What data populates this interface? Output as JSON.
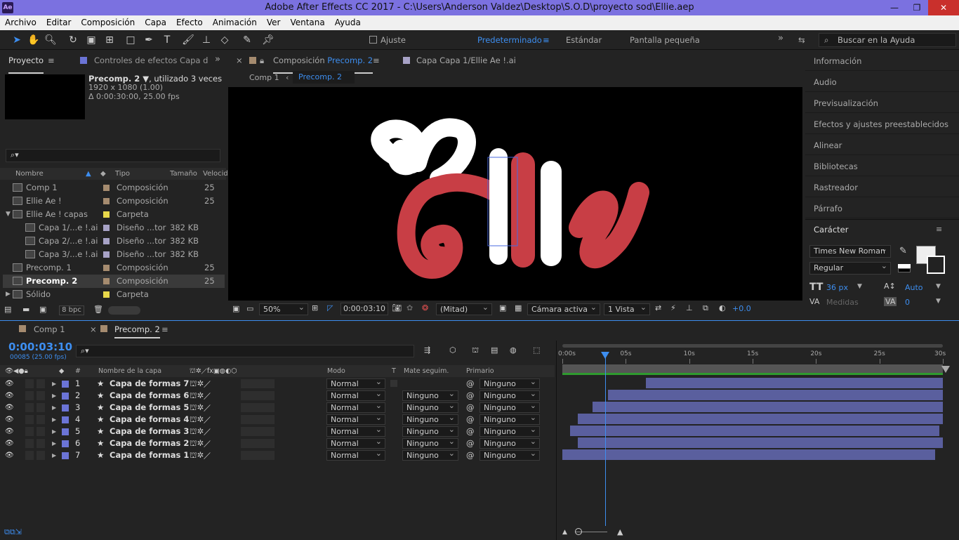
{
  "window": {
    "title": "Adobe After Effects CC 2017 - C:\\Users\\Anderson Valdez\\Desktop\\S.O.D\\proyecto sod\\Ellie.aep",
    "logo": "Ae"
  },
  "menu": [
    "Archivo",
    "Editar",
    "Composición",
    "Capa",
    "Efecto",
    "Animación",
    "Ver",
    "Ventana",
    "Ayuda"
  ],
  "toolbar": {
    "ajuste": "Ajuste",
    "ws_default": "Predeterminado",
    "ws_standard": "Estándar",
    "ws_small": "Pantalla pequeña",
    "help_placeholder": "Buscar en la Ayuda"
  },
  "project": {
    "tab": "Proyecto",
    "effects_tab": "Controles de efectos  Capa d",
    "comp_name": "Precomp. 2 ▼",
    "used": ", utilizado 3 veces",
    "res": "1920 x 1080 (1.00)",
    "dur": "Δ 0:00:30:00, 25.00 fps",
    "cols": {
      "name": "Nombre",
      "type": "Tipo",
      "size": "Tamaño",
      "speed": "Velocid"
    },
    "items": [
      {
        "name": "Comp 1",
        "type": "Composición",
        "size": "25",
        "color": "#a58b6f"
      },
      {
        "name": "Ellie Ae !",
        "type": "Composición",
        "size": "25",
        "color": "#a58b6f"
      },
      {
        "name": "Ellie Ae ! capas",
        "type": "Carpeta",
        "size": "",
        "color": "#e8d84a"
      },
      {
        "name": "Capa 1/...e !.ai",
        "type": "Diseño ...tor",
        "size": "382 KB",
        "color": "#a7a2c6"
      },
      {
        "name": "Capa 2/...e !.ai",
        "type": "Diseño ...tor",
        "size": "382 KB",
        "color": "#a7a2c6"
      },
      {
        "name": "Capa 3/...e !.ai",
        "type": "Diseño ...tor",
        "size": "382 KB",
        "color": "#a7a2c6"
      },
      {
        "name": "Precomp. 1",
        "type": "Composición",
        "size": "25",
        "color": "#a58b6f"
      },
      {
        "name": "Precomp. 2",
        "type": "Composición",
        "size": "25",
        "color": "#a58b6f"
      },
      {
        "name": "Sólido",
        "type": "Carpeta",
        "size": "",
        "color": "#e8d84a"
      }
    ],
    "bpc": "8 bpc"
  },
  "viewer": {
    "tab_prefix": "Composición",
    "tab_comp": "Precomp. 2",
    "layer_tab": "Capa  Capa 1/Ellie Ae !.ai",
    "crumb1": "Comp 1",
    "crumb2": "Precomp. 2",
    "zoom": "50%",
    "time": "0:00:03:10",
    "res": "(Mitad)",
    "camera": "Cámara activa",
    "views": "1 Vista",
    "exposure": "+0.0",
    "artwork_text": "Ellie"
  },
  "right": {
    "items": [
      "Información",
      "Audio",
      "Previsualización",
      "Efectos y ajustes preestablecidos",
      "Alinear",
      "Bibliotecas",
      "Rastreador",
      "Párrafo"
    ],
    "character": "Carácter",
    "font": "Times New Roman",
    "style": "Regular",
    "size": "36 px",
    "leading": "Auto",
    "tracking_label": "Medidas",
    "tracking": "0"
  },
  "timeline": {
    "tab1": "Comp 1",
    "tab2": "Precomp. 2",
    "time": "0:00:03:10",
    "frames": "00085 (25.00 fps)",
    "cols": {
      "num": "#",
      "name": "Nombre de la capa",
      "mode": "Modo",
      "t": "T",
      "matte": "Mate seguim.",
      "parent": "Primario"
    },
    "ruler": [
      "0:00s",
      "05s",
      "10s",
      "15s",
      "20s",
      "25s",
      "30s"
    ],
    "layers": [
      {
        "num": "1",
        "name": "Capa de formas 7",
        "mode": "Normal",
        "matte": "",
        "parent": "Ninguno",
        "start": 0.22,
        "end": 1.0
      },
      {
        "num": "2",
        "name": "Capa de formas 6",
        "mode": "Normal",
        "matte": "Ninguno",
        "parent": "Ninguno",
        "start": 0.12,
        "end": 1.0
      },
      {
        "num": "3",
        "name": "Capa de formas 5",
        "mode": "Normal",
        "matte": "Ninguno",
        "parent": "Ninguno",
        "start": 0.08,
        "end": 1.0
      },
      {
        "num": "4",
        "name": "Capa de formas 4",
        "mode": "Normal",
        "matte": "Ninguno",
        "parent": "Ninguno",
        "start": 0.04,
        "end": 1.0
      },
      {
        "num": "5",
        "name": "Capa de formas 3",
        "mode": "Normal",
        "matte": "Ninguno",
        "parent": "Ninguno",
        "start": 0.02,
        "end": 0.99
      },
      {
        "num": "6",
        "name": "Capa de formas 2",
        "mode": "Normal",
        "matte": "Ninguno",
        "parent": "Ninguno",
        "start": 0.04,
        "end": 1.0
      },
      {
        "num": "7",
        "name": "Capa de formas 1",
        "mode": "Normal",
        "matte": "Ninguno",
        "parent": "Ninguno",
        "start": 0.0,
        "end": 0.98
      }
    ],
    "playhead": 0.113
  }
}
